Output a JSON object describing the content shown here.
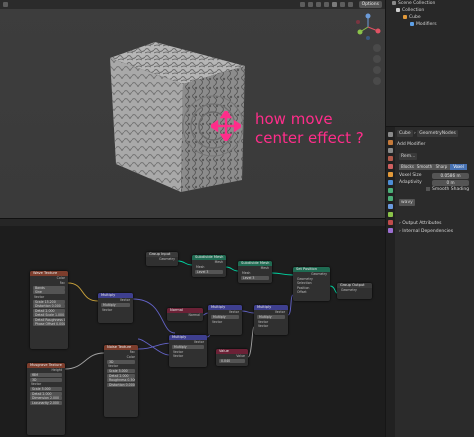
{
  "viewport": {
    "options_label": "Options",
    "annotation": "how move\ncenter effect ?"
  },
  "outliner": {
    "items": [
      {
        "label": "Scene Collection"
      },
      {
        "label": "Collection"
      },
      {
        "label": "Cube"
      },
      {
        "label": "Modifiers"
      }
    ]
  },
  "properties": {
    "breadcrumb_object": "Cube",
    "breadcrumb_modifier": "GeometryNodes",
    "add_modifier_label": "Add Modifier",
    "modifier_name": "Rem...",
    "remesh_modes": [
      "Blocks",
      "Smooth",
      "Sharp",
      "Voxel"
    ],
    "voxel_size_label": "Voxel Size",
    "voxel_size_value": "0.0586 m",
    "adaptivity_label": "Adaptivity",
    "adaptivity_value": "0 m",
    "smooth_shading_label": "Smooth Shading",
    "gn_name": "wavy",
    "output_attributes_label": "Output Attributes",
    "internal_dependencies_label": "Internal Dependencies"
  },
  "nodes": {
    "wave_texture": {
      "title": "Wave Texture",
      "rows": [
        "Color",
        "Fac",
        "Bands",
        "Sine",
        "Vector"
      ],
      "fields": [
        "Scale 15.200",
        "Distortion 0.000",
        "Detail 2.000",
        "Detail Scale 1.000",
        "Detail Roughness 0.500",
        "Phase Offset 0.000"
      ]
    },
    "group_input": {
      "title": "Group Input",
      "rows": [
        "Geometry"
      ]
    },
    "subdivide_mesh": {
      "title": "Subdivide Mesh",
      "rows": [
        "Mesh",
        "Mesh",
        "Level 3"
      ]
    },
    "set_position": {
      "title": "Set Position",
      "rows": [
        "Geometry",
        "Geometry",
        "Selection",
        "Position",
        "Offset"
      ]
    },
    "group_output": {
      "title": "Group Output",
      "rows": [
        "Geometry"
      ]
    },
    "multiply_1": {
      "title": "Multiply",
      "rows": [
        "Vector",
        "Multiply",
        "Vector"
      ]
    },
    "normal": {
      "title": "Normal",
      "rows": [
        "Normal"
      ]
    },
    "multiply_2": {
      "title": "Multiply",
      "rows": [
        "Vector",
        "Multiply",
        "Vector"
      ]
    },
    "multiply_3": {
      "title": "Multiply",
      "rows": [
        "Vector",
        "Multiply",
        "Vector",
        "Vector"
      ]
    },
    "multiply_4": {
      "title": "Multiply",
      "rows": [
        "Vector",
        "Multiply",
        "Vector",
        "Vector"
      ]
    },
    "noise_texture": {
      "title": "Noise Texture",
      "rows": [
        "Fac",
        "Color",
        "3D",
        "Vector"
      ],
      "fields": [
        "Scale 5.000",
        "Detail 2.000",
        "Roughness 0.500",
        "Distortion 0.000"
      ]
    },
    "value": {
      "title": "Value",
      "rows": [
        "Value"
      ],
      "fields": [
        "0.040"
      ]
    },
    "musgrave": {
      "title": "Musgrave Texture",
      "rows": [
        "Height",
        "fBM",
        "3D",
        "Vector"
      ],
      "fields": [
        "Scale 5.000",
        "Detail 2.000",
        "Dimension 2.000",
        "Lacunarity 2.000"
      ]
    }
  }
}
